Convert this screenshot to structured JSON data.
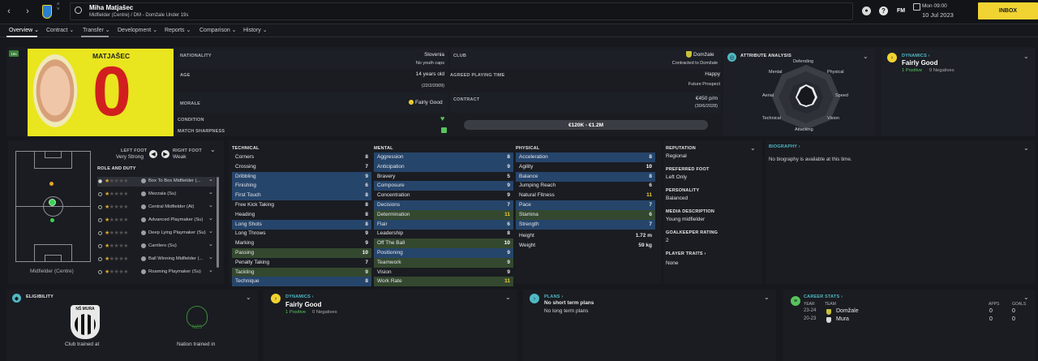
{
  "header": {
    "player_name": "Miha Matjašec",
    "player_sub": "Midfielder (Centre) / DM - Domžale Under 19s",
    "time": "Mon 09:00",
    "date": "10 Jul 2023",
    "inbox": "INBOX",
    "fm": "FM"
  },
  "nav": {
    "tabs": [
      "Overview ⌄",
      "Contract ⌄",
      "Transfer ⌄",
      "Development ⌄",
      "Reports ⌄",
      "Comparison ⌄",
      "History ⌄"
    ]
  },
  "profile": {
    "badge": "19s",
    "shirt_name": "MATJAŠEC",
    "shirt_number": "0"
  },
  "info": {
    "nationality_label": "NATIONALITY",
    "nationality": "Slovenia",
    "youth_caps": "No youth caps",
    "age_label": "AGE",
    "age": "14 years old",
    "dob": "(22/2/2009)",
    "morale_label": "MORALE",
    "morale": "Fairly Good",
    "condition_label": "CONDITION",
    "sharpness_label": "MATCH SHARPNESS",
    "club_label": "CLUB",
    "club": "Domžale",
    "club_contract": "Contracted to Domžale",
    "apt_label": "AGREED PLAYING TIME",
    "apt": "Happy",
    "apt_sub": "Future Prospect",
    "contract_label": "CONTRACT",
    "wage": "€450 p/m",
    "contract_end": "(30/6/2028)",
    "value": "€120K - €1.2M"
  },
  "attr_analysis": {
    "title": "ATTRIBUTE ANALYSIS",
    "labels": [
      "Defending",
      "Physical",
      "Speed",
      "Vision",
      "Attacking",
      "Technical",
      "Aerial",
      "Mental"
    ]
  },
  "dynamics_top": {
    "title": "DYNAMICS ›",
    "value": "Fairly Good",
    "positive": "1 Positive",
    "negative": "0 Negatives"
  },
  "pitch": {
    "position": "Midfielder (Centre)"
  },
  "feet": {
    "left_label": "LEFT FOOT",
    "left": "Very Strong",
    "right_label": "RIGHT FOOT",
    "right": "Weak"
  },
  "roles": {
    "title": "ROLE AND DUTY",
    "items": [
      "Box To Box Midfielder (...",
      "Mezzala (Su)",
      "Central Midfielder (At)",
      "Advanced Playmaker (Su)",
      "Deep Lying Playmaker (Su)",
      "Carrilero (Su)",
      "Ball Winning Midfielder (...",
      "Roaming Playmaker (Su)"
    ]
  },
  "technical": {
    "title": "TECHNICAL",
    "rows": [
      {
        "name": "Corners",
        "value": "8"
      },
      {
        "name": "Crossing",
        "value": "7"
      },
      {
        "name": "Dribbling",
        "value": "9"
      },
      {
        "name": "Finishing",
        "value": "6"
      },
      {
        "name": "First Touch",
        "value": "8"
      },
      {
        "name": "Free Kick Taking",
        "value": "8"
      },
      {
        "name": "Heading",
        "value": "8"
      },
      {
        "name": "Long Shots",
        "value": "8"
      },
      {
        "name": "Long Throws",
        "value": "9"
      },
      {
        "name": "Marking",
        "value": "9"
      },
      {
        "name": "Passing",
        "value": "10"
      },
      {
        "name": "Penalty Taking",
        "value": "7"
      },
      {
        "name": "Tackling",
        "value": "9"
      },
      {
        "name": "Technique",
        "value": "8"
      }
    ]
  },
  "mental": {
    "title": "MENTAL",
    "rows": [
      {
        "name": "Aggression",
        "value": "8"
      },
      {
        "name": "Anticipation",
        "value": "9"
      },
      {
        "name": "Bravery",
        "value": "5"
      },
      {
        "name": "Composure",
        "value": "9"
      },
      {
        "name": "Concentration",
        "value": "9"
      },
      {
        "name": "Decisions",
        "value": "7"
      },
      {
        "name": "Determination",
        "value": "11"
      },
      {
        "name": "Flair",
        "value": "6"
      },
      {
        "name": "Leadership",
        "value": "8"
      },
      {
        "name": "Off The Ball",
        "value": "10"
      },
      {
        "name": "Positioning",
        "value": "9"
      },
      {
        "name": "Teamwork",
        "value": "9"
      },
      {
        "name": "Vision",
        "value": "9"
      },
      {
        "name": "Work Rate",
        "value": "11"
      }
    ]
  },
  "physical": {
    "title": "PHYSICAL",
    "rows": [
      {
        "name": "Acceleration",
        "value": "8"
      },
      {
        "name": "Agility",
        "value": "10"
      },
      {
        "name": "Balance",
        "value": "8"
      },
      {
        "name": "Jumping Reach",
        "value": "6"
      },
      {
        "name": "Natural Fitness",
        "value": "11"
      },
      {
        "name": "Pace",
        "value": "7"
      },
      {
        "name": "Stamina",
        "value": "6"
      },
      {
        "name": "Strength",
        "value": "7"
      }
    ],
    "height_label": "Height",
    "height": "1.72 m",
    "weight_label": "Weight",
    "weight": "59 kg"
  },
  "details": {
    "reputation_label": "REPUTATION",
    "reputation": "Regional",
    "pref_foot_label": "PREFERRED FOOT",
    "pref_foot": "Left Only",
    "personality_label": "PERSONALITY",
    "personality": "Balanced",
    "media_label": "MEDIA DESCRIPTION",
    "media": "Young midfielder",
    "gk_label": "GOALKEEPER RATING",
    "gk": "2",
    "traits_label": "PLAYER TRAITS ›",
    "traits": "None"
  },
  "biography": {
    "title": "BIOGRAPHY ›",
    "text": "No biography is available at this time."
  },
  "eligibility": {
    "title": "ELIGIBILITY",
    "club_badge": "NŠ MURA",
    "club_trained": "Club trained at",
    "nation_badge": "NZS",
    "nation_trained": "Nation trained in"
  },
  "dynamics_bottom": {
    "title": "DYNAMICS ›",
    "value": "Fairly Good",
    "positive": "1 Positive",
    "negative": "0 Negatives"
  },
  "plans": {
    "title": "PLANS ›",
    "short": "No short term plans",
    "long": "No long term plans"
  },
  "career": {
    "title": "CAREER STATS ›",
    "col_year": "YEAR",
    "col_team": "TEAM",
    "col_apps": "APPS",
    "col_goals": "GOALS",
    "rows": [
      {
        "year": "23-24",
        "team": "Domžale",
        "apps": "0",
        "goals": "0"
      },
      {
        "year": "20-23",
        "team": "Mura",
        "apps": "0",
        "goals": "0"
      }
    ]
  },
  "colors": {
    "accent": "#f1d331",
    "cyan": "#4fb9c4",
    "green": "#57c45c",
    "blue_row": "#26456b",
    "green_row": "#34482f"
  }
}
